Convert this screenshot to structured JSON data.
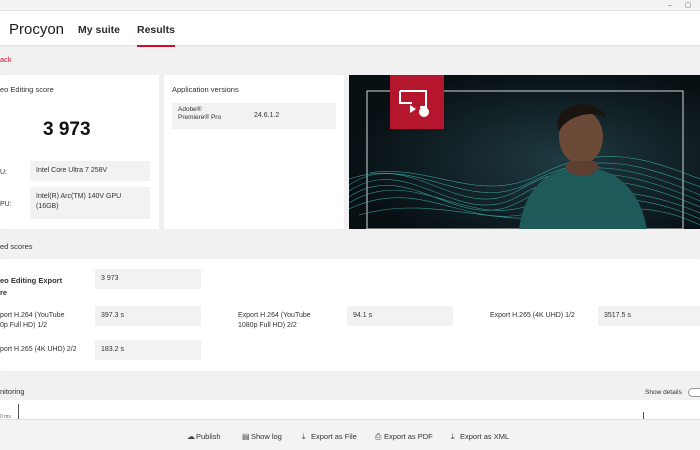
{
  "app": {
    "brand": "Procyon"
  },
  "nav": {
    "tabs": [
      {
        "label": "My suite"
      },
      {
        "label": "Results"
      }
    ]
  },
  "back_label": "ack",
  "score_card": {
    "title": "eo Editing score",
    "score": "3 973",
    "cpu_label": "U:",
    "cpu_value": "Intel Core Ultra 7 258V",
    "gpu_label": "PU:",
    "gpu_value_line1": "Intel(R) Arc(TM) 140V GPU",
    "gpu_value_line2": "(16GB)"
  },
  "app_versions": {
    "title": "Application versions",
    "app_name_line1": "Adobe®",
    "app_name_line2": "Premiere® Pro",
    "app_version": "24.6.1.2"
  },
  "detailed": {
    "title": "ed scores",
    "export_score_label_line1": "eo Editing Export",
    "export_score_label_line2": "re",
    "export_score_value": "3 973",
    "rows": [
      {
        "label_line1": "port H.264 (YouTube",
        "label_line2": "0p Full HD) 1/2",
        "value": "397.3 s"
      },
      {
        "label_line1": "Export H.264 (YouTube",
        "label_line2": "1080p Full HD) 2/2",
        "value": "94.1 s"
      },
      {
        "label_line1": "Export H.265 (4K UHD) 1/2",
        "label_line2": "",
        "value": "3517.5 s"
      },
      {
        "label_line1": "port H.265 (4K UHD) 2/2",
        "label_line2": "",
        "value": "183.2 s"
      }
    ]
  },
  "monitoring": {
    "title": "nitoring",
    "show_details_label": "Show details",
    "axis_tick": "0 ms"
  },
  "footer": {
    "buttons": [
      {
        "label": "Publish",
        "icon": "cloud-upload-icon"
      },
      {
        "label": "Show log",
        "icon": "document-icon"
      },
      {
        "label": "Export as File",
        "icon": "download-icon"
      },
      {
        "label": "Export as PDF",
        "icon": "printer-icon"
      },
      {
        "label": "Export as XML",
        "icon": "download-icon"
      }
    ]
  },
  "colors": {
    "accent": "#c8102e",
    "hero_bg": "#0a1418",
    "teal_lines": "#3fb5b0"
  }
}
